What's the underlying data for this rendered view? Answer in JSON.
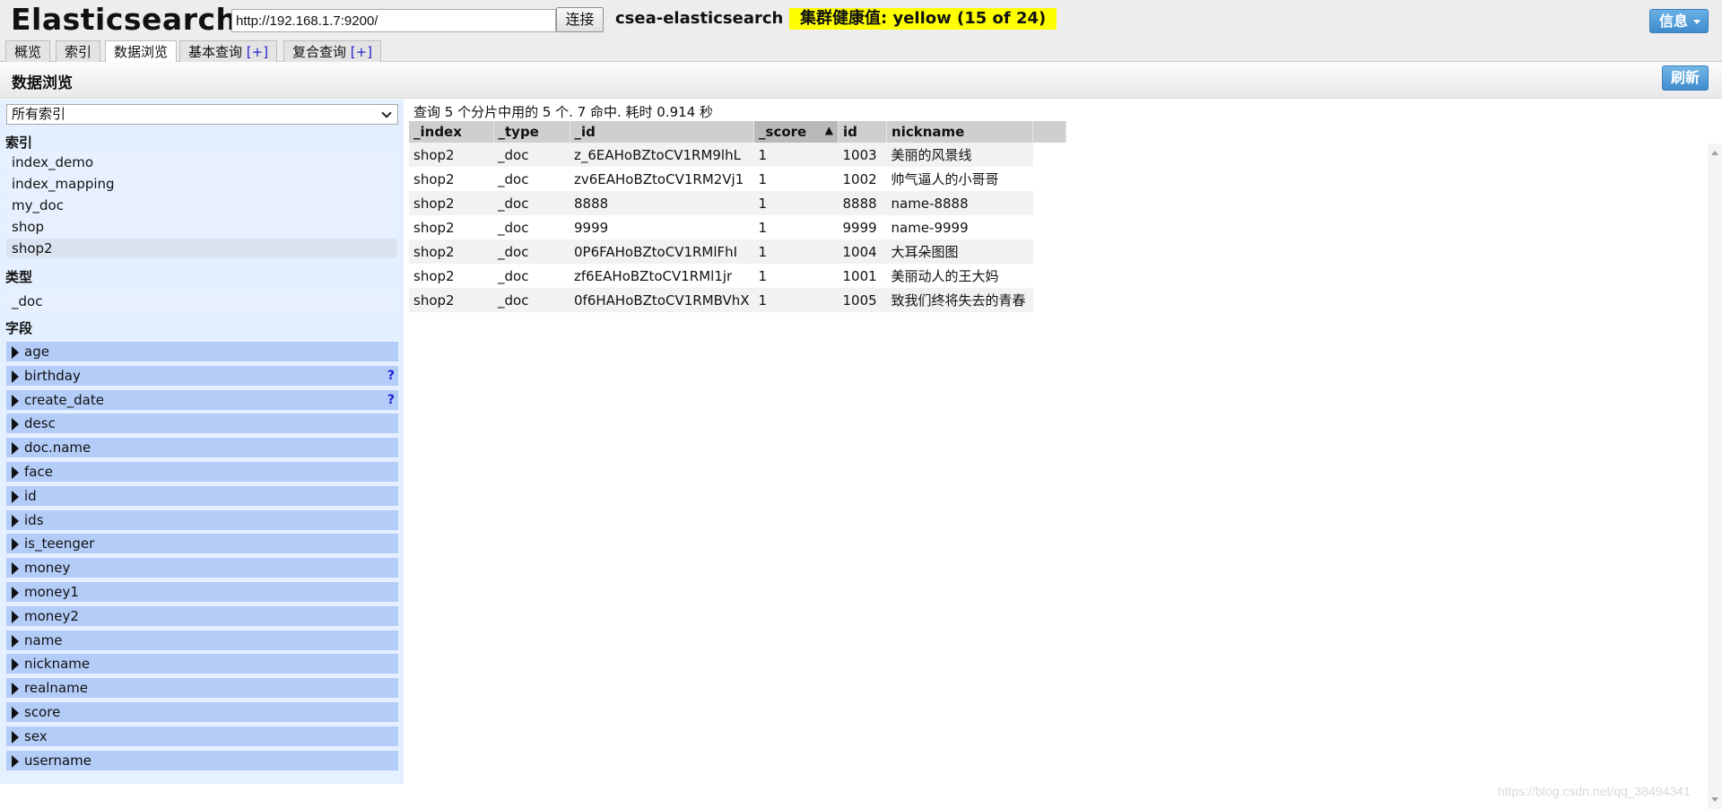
{
  "header": {
    "logo": "Elasticsearch",
    "url": "http://192.168.1.7:9200/",
    "connect_label": "连接",
    "cluster_name": "csea-elasticsearch",
    "cluster_health": "集群健康值: yellow (15 of 24)",
    "info_label": "信息"
  },
  "tabs": [
    {
      "label": "概览"
    },
    {
      "label": "索引"
    },
    {
      "label": "数据浏览"
    },
    {
      "label": "基本查询",
      "plus": "[+]"
    },
    {
      "label": "复合查询",
      "plus": "[+]"
    }
  ],
  "subheader": {
    "title": "数据浏览",
    "refresh_label": "刷新"
  },
  "sidebar": {
    "index_select": "所有索引",
    "indices_label": "索引",
    "indices": [
      "index_demo",
      "index_mapping",
      "my_doc",
      "shop",
      "shop2"
    ],
    "types_label": "类型",
    "types": [
      "_doc"
    ],
    "fields_label": "字段",
    "fields": [
      {
        "name": "age"
      },
      {
        "name": "birthday",
        "help": "?"
      },
      {
        "name": "create_date",
        "help": "?"
      },
      {
        "name": "desc"
      },
      {
        "name": "doc.name"
      },
      {
        "name": "face"
      },
      {
        "name": "id"
      },
      {
        "name": "ids"
      },
      {
        "name": "is_teenger"
      },
      {
        "name": "money"
      },
      {
        "name": "money1"
      },
      {
        "name": "money2"
      },
      {
        "name": "name"
      },
      {
        "name": "nickname"
      },
      {
        "name": "realname"
      },
      {
        "name": "score"
      },
      {
        "name": "sex"
      },
      {
        "name": "username"
      }
    ]
  },
  "main": {
    "query_info": "查询 5 个分片中用的 5 个. 7 命中. 耗时 0.914 秒",
    "columns": [
      "_index",
      "_type",
      "_id",
      "_score",
      "id",
      "nickname"
    ],
    "sort_arrow": "▲",
    "rows": [
      [
        "shop2",
        "_doc",
        "z_6EAHoBZtoCV1RM9lhL",
        "1",
        "1003",
        "美丽的风景线"
      ],
      [
        "shop2",
        "_doc",
        "zv6EAHoBZtoCV1RM2Vj1",
        "1",
        "1002",
        "帅气逼人的小哥哥"
      ],
      [
        "shop2",
        "_doc",
        "8888",
        "1",
        "8888",
        "name-8888"
      ],
      [
        "shop2",
        "_doc",
        "9999",
        "1",
        "9999",
        "name-9999"
      ],
      [
        "shop2",
        "_doc",
        "0P6FAHoBZtoCV1RMlFhI",
        "1",
        "1004",
        "大耳朵图图"
      ],
      [
        "shop2",
        "_doc",
        "zf6EAHoBZtoCV1RMl1jr",
        "1",
        "1001",
        "美丽动人的王大妈"
      ],
      [
        "shop2",
        "_doc",
        "0f6HAHoBZtoCV1RMBVhX",
        "1",
        "1005",
        "致我们终将失去的青春"
      ]
    ]
  },
  "watermark": "https://blog.csdn.net/qq_38494341"
}
